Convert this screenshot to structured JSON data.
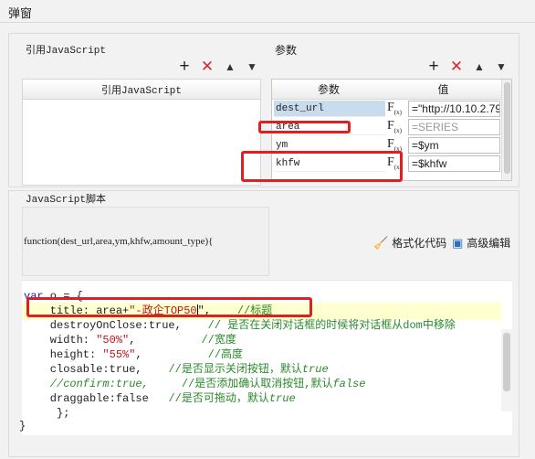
{
  "dialog": {
    "title": "弹窗"
  },
  "js_ref": {
    "legend": "引用JavaScript",
    "column_header": "引用JavaScript",
    "toolbar": {
      "add_icon": "plus-icon",
      "delete_icon": "delete-x-icon",
      "up_icon": "arrow-up-icon",
      "down_icon": "arrow-down-icon"
    }
  },
  "params": {
    "legend": "参数",
    "headers": {
      "name": "参数",
      "value": "值"
    },
    "rows": [
      {
        "name": "dest_url",
        "fx": "F",
        "fx_sub": "(x)",
        "value": "=\"http://10.10.2.79",
        "selected": true,
        "placeholder": false
      },
      {
        "name": "area",
        "fx": "F",
        "fx_sub": "(x)",
        "value": "=SERIES",
        "selected": false,
        "placeholder": true
      },
      {
        "name": "ym",
        "fx": "F",
        "fx_sub": "(x)",
        "value": "=$ym",
        "selected": false,
        "placeholder": false
      },
      {
        "name": "khfw",
        "fx": "F",
        "fx_sub": "(x)",
        "value": "=$khfw",
        "selected": false,
        "placeholder": false
      }
    ]
  },
  "script": {
    "legend": "JavaScript脚本",
    "signature": "function(dest_url,area,ym,khfw,amount_type){",
    "format_label": "格式化代码",
    "advanced_label": "高级编辑",
    "code": {
      "l1_kw": "var",
      "l1_rest": " o = {",
      "l2_a": "    title: area+",
      "l2_str": "\"-政企TOP50",
      "l2_b": "\",    ",
      "l2_cm": "//标题",
      "l3_a": "    destroyOnClose:true,    ",
      "l3_cm": "// 是否在关闭对话框的时候将对话框从dom中移除",
      "l4_a": "    width: ",
      "l4_str": "\"50%\"",
      "l4_b": ",          ",
      "l4_cm": "//宽度",
      "l5_a": "    height: ",
      "l5_str": "\"55%\"",
      "l5_b": ",          ",
      "l5_cm": "//高度",
      "l6_a": "    closable:true,    ",
      "l6_cm": "//是否显示关闭按钮，默认",
      "l6_cmi": "true",
      "l7_cmi": "    //confirm:true,",
      "l7_gap": "     ",
      "l7_cm": "//是否添加确认取消按钮,默认",
      "l7_cmi2": "false",
      "l8_a": "    draggable:false   ",
      "l8_cm": "//是否可拖动，默认",
      "l8_cmi": "true",
      "l9": "     };",
      "l10": "}"
    }
  },
  "colors": {
    "highlight_box": "#e02020",
    "delete_icon": "#d62b2b",
    "selected_row": "#c9dced",
    "current_line": "#ffffcf"
  }
}
